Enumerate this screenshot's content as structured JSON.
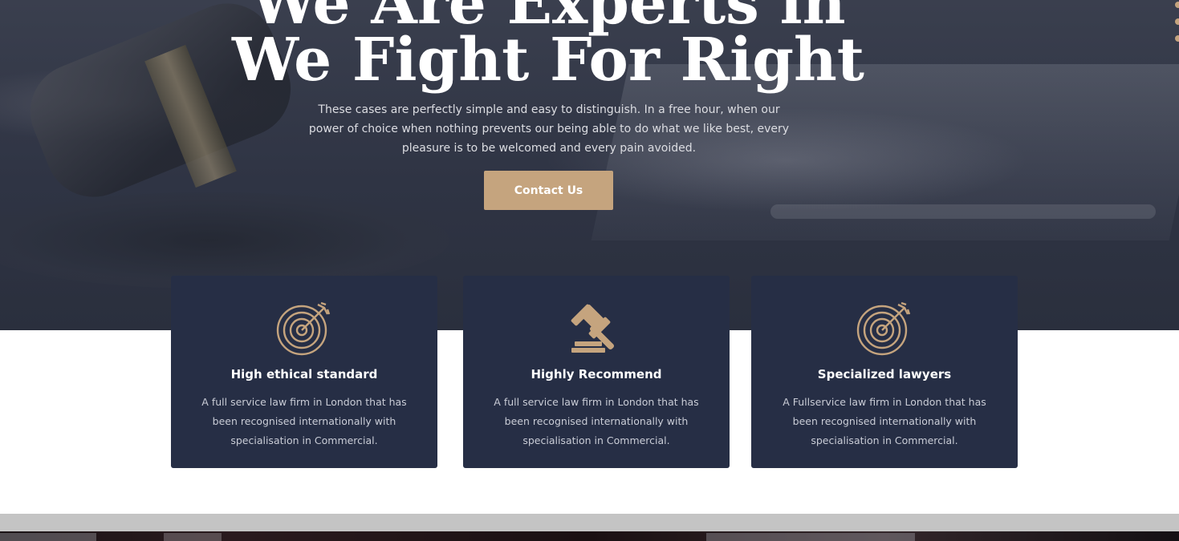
{
  "hero": {
    "title_line1": "We Are Experts in",
    "title_line2": "We Fight For Right",
    "description": "These cases are perfectly simple and easy to distinguish. In a free hour, when our power of choice when nothing prevents our being able to do what we like best, every pleasure is to be welcomed and every pain avoided.",
    "cta_label": "Contact  Us"
  },
  "features": [
    {
      "icon": "target-arrow-icon",
      "title": "High ethical standard",
      "description": "A full service law firm in London that has been recognised internationally with specialisation in Commercial."
    },
    {
      "icon": "gavel-icon",
      "title": "Highly Recommend",
      "description": "A full service law firm in London that has been recognised internationally with specialisation in Commercial."
    },
    {
      "icon": "target-arrow-icon",
      "title": "Specialized lawyers",
      "description": "A Fullservice law firm in London that has been recognised internationally with specialisation in Commercial."
    }
  ],
  "colors": {
    "accent": "#c5a47e",
    "card_bg": "#262e45",
    "hero_overlay": "#2f3444"
  }
}
